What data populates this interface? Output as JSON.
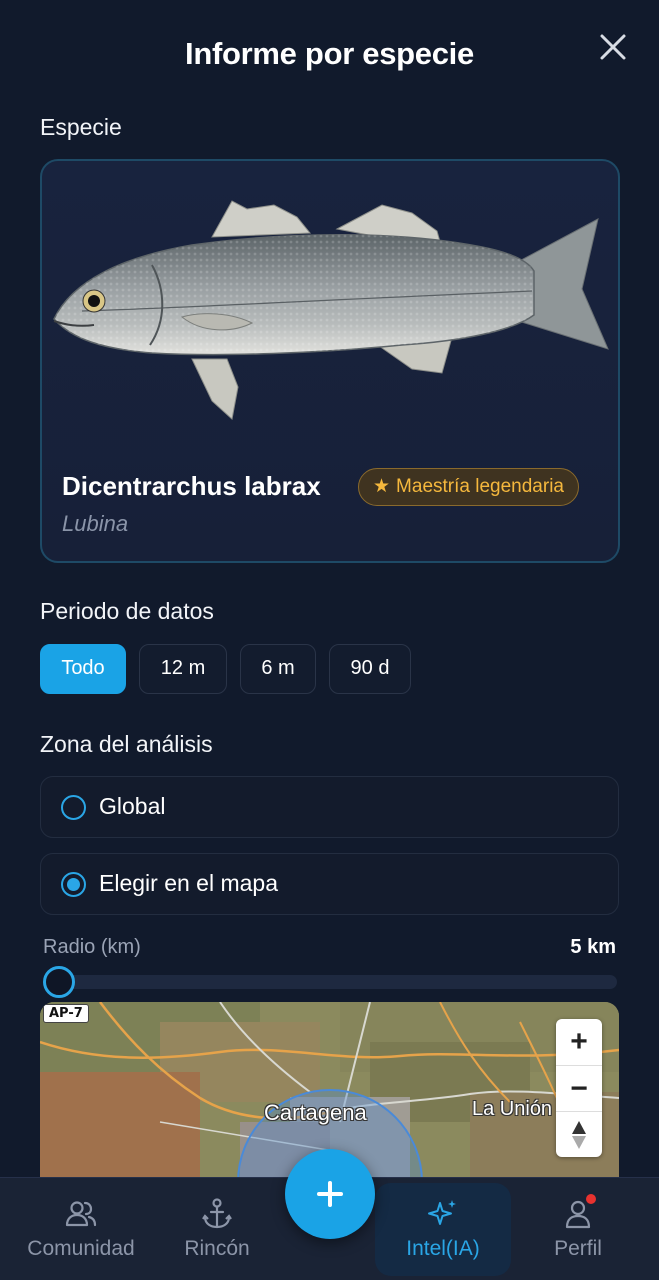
{
  "header": {
    "title": "Informe por especie",
    "close_icon": "close-icon"
  },
  "species_section": {
    "label": "Especie",
    "scientific_name": "Dicentrarchus labrax",
    "common_name": "Lubina",
    "badge": {
      "icon": "star-icon",
      "star": "★",
      "label": "Maestría legendaria",
      "color": "#f5b83d"
    }
  },
  "period_section": {
    "label": "Periodo de datos",
    "options": [
      {
        "label": "Todo",
        "selected": true
      },
      {
        "label": "12 m",
        "selected": false
      },
      {
        "label": "6 m",
        "selected": false
      },
      {
        "label": "90 d",
        "selected": false
      }
    ]
  },
  "zone_section": {
    "label": "Zona del análisis",
    "options": [
      {
        "label": "Global",
        "selected": false
      },
      {
        "label": "Elegir en el mapa",
        "selected": true
      }
    ]
  },
  "radius": {
    "label": "Radio (km)",
    "value_text": "5 km",
    "value_km": 5
  },
  "map": {
    "road_tag": "AP-7",
    "places": [
      "Cartagena",
      "La Unión"
    ],
    "controls": {
      "zoom_in": "+",
      "zoom_out": "−",
      "compass_icon": "compass-icon"
    }
  },
  "bottom_nav": {
    "items": [
      {
        "label": "Comunidad",
        "icon": "users-icon",
        "active": false
      },
      {
        "label": "Rincón",
        "icon": "anchor-icon",
        "active": false
      },
      {
        "label": "Intel(IA)",
        "icon": "sparkle-icon",
        "active": true
      },
      {
        "label": "Perfil",
        "icon": "profile-icon",
        "active": false,
        "notification": true
      }
    ],
    "fab_icon": "plus-icon"
  },
  "colors": {
    "accent": "#1aa3e6",
    "background": "#111a2c",
    "badge_gold": "#f5b83d",
    "notification": "#e8322f"
  }
}
